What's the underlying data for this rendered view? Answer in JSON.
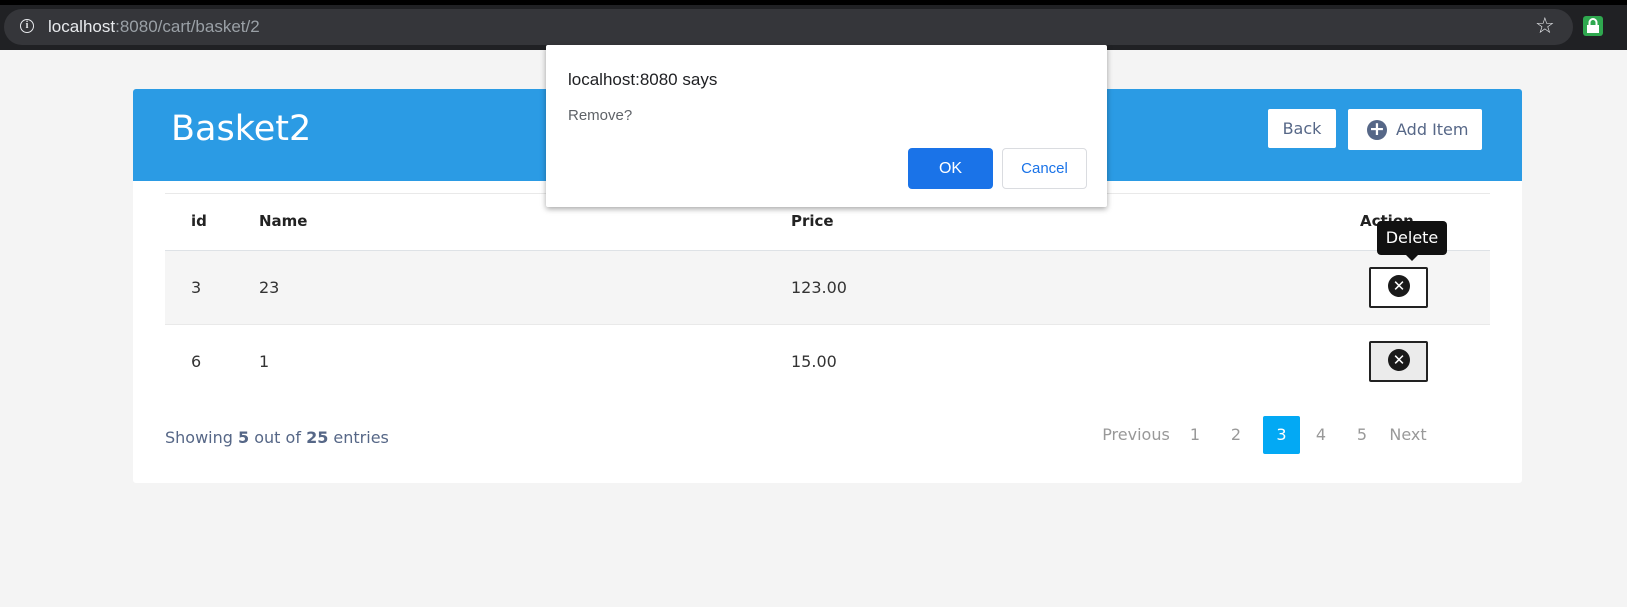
{
  "browser": {
    "url_host": "localhost",
    "url_rest": ":8080/cart/basket/2"
  },
  "header": {
    "title": "Basket2",
    "back_label": "Back",
    "add_label": "Add Item"
  },
  "table": {
    "columns": [
      "id",
      "Name",
      "Price",
      "Action"
    ],
    "rows": [
      {
        "id": "3",
        "name": "23",
        "price": "123.00"
      },
      {
        "id": "6",
        "name": "1",
        "price": "15.00"
      }
    ],
    "tooltip": "Delete"
  },
  "footer": {
    "hint_prefix": "Showing",
    "shown": "5",
    "hint_middle": "out of",
    "total": "25",
    "hint_suffix": "entries",
    "pagination": {
      "previous": "Previous",
      "pages": [
        "1",
        "2",
        "3",
        "4",
        "5"
      ],
      "active": "3",
      "next": "Next"
    }
  },
  "dialog": {
    "title": "localhost:8080 says",
    "message": "Remove?",
    "ok_label": "OK",
    "cancel_label": "Cancel"
  },
  "colors": {
    "header_blue": "#2b9be4",
    "pager_active": "#03a9f4",
    "dialog_ok": "#1a73e8"
  }
}
